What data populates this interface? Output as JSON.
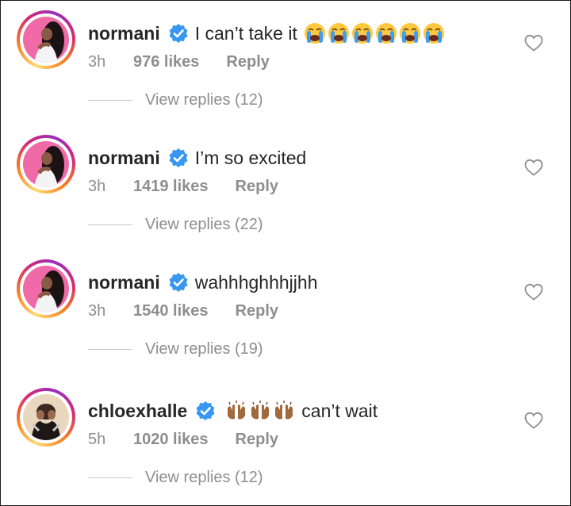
{
  "comments": [
    {
      "username": "normani",
      "text": "I can’t take it",
      "emoji_after": [
        "loudly-crying-face",
        "loudly-crying-face",
        "loudly-crying-face",
        "loudly-crying-face",
        "loudly-crying-face",
        "loudly-crying-face"
      ],
      "emoji_before": [],
      "time": "3h",
      "likes": "976 likes",
      "reply": "Reply",
      "view_replies": "View replies (12)"
    },
    {
      "username": "normani",
      "text": "I’m so excited",
      "emoji_after": [],
      "emoji_before": [],
      "time": "3h",
      "likes": "1419 likes",
      "reply": "Reply",
      "view_replies": "View replies (22)"
    },
    {
      "username": "normani",
      "text": "wahhhghhhjjhh",
      "emoji_after": [],
      "emoji_before": [],
      "time": "3h",
      "likes": "1540 likes",
      "reply": "Reply",
      "view_replies": "View replies (19)"
    },
    {
      "username": "chloexhalle",
      "text": "can’t wait",
      "emoji_after": [],
      "emoji_before": [
        "raising-hands",
        "raising-hands",
        "raising-hands"
      ],
      "time": "5h",
      "likes": "1020 likes",
      "reply": "Reply",
      "view_replies": "View replies (12)"
    }
  ],
  "colors": {
    "verified_badge": "#3897f0",
    "secondary_text": "#8e8e8e",
    "primary_text": "#262626"
  }
}
